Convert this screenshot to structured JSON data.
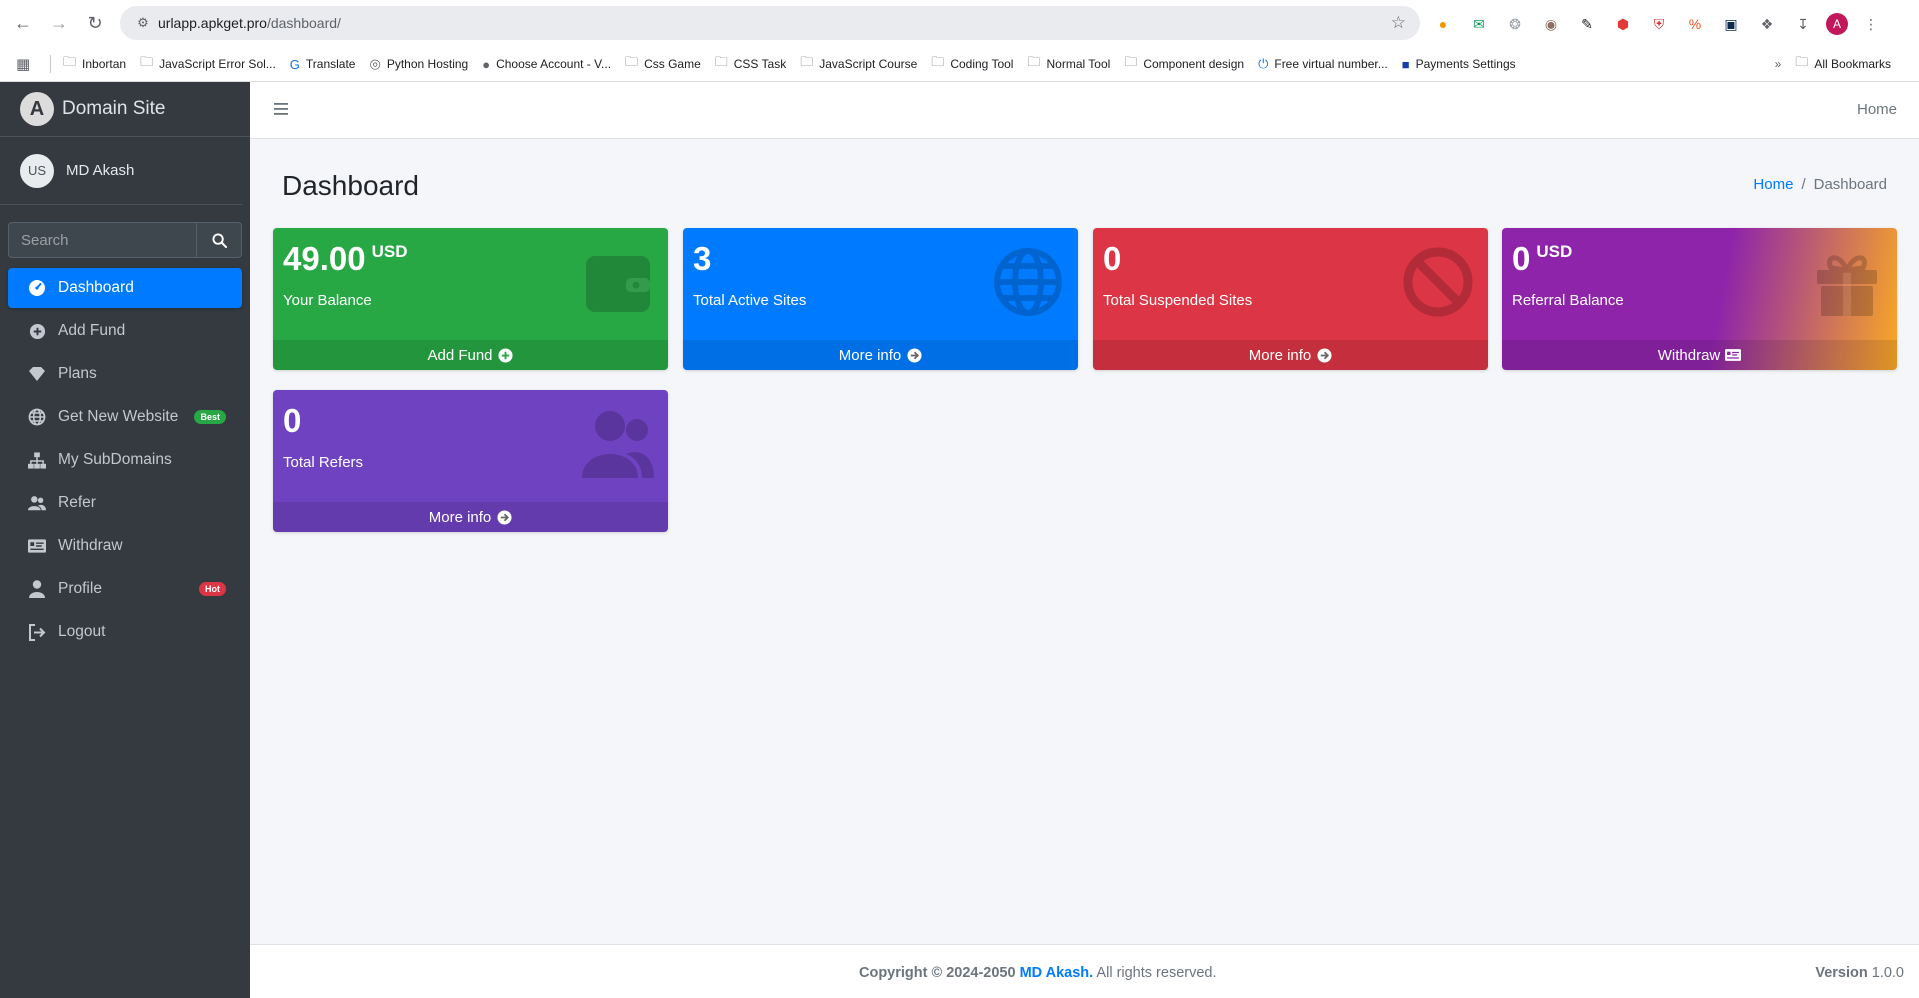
{
  "browser": {
    "url_host": "urlapp.apkget.pro",
    "url_path": "/dashboard/",
    "profile_initial": "A",
    "bookmarks": [
      {
        "label": "Inbortan",
        "icon": "folder-icon"
      },
      {
        "label": "JavaScript Error Sol...",
        "icon": "folder-icon"
      },
      {
        "label": "Translate",
        "icon": "translate-icon"
      },
      {
        "label": "Python Hosting",
        "icon": "globe-icon"
      },
      {
        "label": "Choose Account - V...",
        "icon": "site-icon"
      },
      {
        "label": "Css Game",
        "icon": "folder-icon"
      },
      {
        "label": "CSS Task",
        "icon": "folder-icon"
      },
      {
        "label": "JavaScript Course",
        "icon": "folder-icon"
      },
      {
        "label": "Coding Tool",
        "icon": "folder-icon"
      },
      {
        "label": "Normal Tool",
        "icon": "folder-icon"
      },
      {
        "label": "Component design",
        "icon": "folder-icon"
      },
      {
        "label": "Free virtual number...",
        "icon": "power-icon"
      },
      {
        "label": "Payments Settings",
        "icon": "square-icon"
      }
    ],
    "all_bookmarks": "All Bookmarks"
  },
  "sidebar": {
    "brand": "Domain Site",
    "brand_logo": "A",
    "user_initials": "US",
    "user_name": "MD Akash",
    "search_placeholder": "Search",
    "items": [
      {
        "label": "Dashboard",
        "icon": "dashboard-icon",
        "active": true
      },
      {
        "label": "Add Fund",
        "icon": "plus-circle-icon"
      },
      {
        "label": "Plans",
        "icon": "gem-icon"
      },
      {
        "label": "Get New Website",
        "icon": "globe-icon",
        "badge": "Best"
      },
      {
        "label": "My SubDomains",
        "icon": "sitemap-icon"
      },
      {
        "label": "Refer",
        "icon": "users-icon"
      },
      {
        "label": "Withdraw",
        "icon": "money-check-icon"
      },
      {
        "label": "Profile",
        "icon": "user-icon",
        "badge": "Hot"
      },
      {
        "label": "Logout",
        "icon": "logout-icon"
      }
    ]
  },
  "topbar": {
    "home": "Home"
  },
  "page": {
    "title": "Dashboard",
    "breadcrumb_home": "Home",
    "breadcrumb_sep": "/",
    "breadcrumb_current": "Dashboard"
  },
  "cards": [
    {
      "value": "49.00",
      "unit": "USD",
      "label": "Your Balance",
      "footer": "Add Fund",
      "color": "#28a745",
      "icon": "wallet-icon",
      "footer_icon": "plus-circle-icon"
    },
    {
      "value": "3",
      "unit": "",
      "label": "Total Active Sites",
      "footer": "More info",
      "color": "#007bff",
      "icon": "globe-icon",
      "footer_icon": "arrow-circle-right-icon"
    },
    {
      "value": "0",
      "unit": "",
      "label": "Total Suspended Sites",
      "footer": "More info",
      "color": "#dc3545",
      "icon": "ban-icon",
      "footer_icon": "arrow-circle-right-icon"
    },
    {
      "value": "0",
      "unit": "USD",
      "label": "Referral Balance",
      "footer": "Withdraw",
      "color": "#8e24aa",
      "icon": "gift-icon",
      "footer_icon": "money-check-icon"
    },
    {
      "value": "0",
      "unit": "",
      "label": "Total Refers",
      "footer": "More info",
      "color": "#6f42c1",
      "icon": "users-icon",
      "footer_icon": "arrow-circle-right-icon"
    }
  ],
  "footer": {
    "copyright": "Copyright © 2024-2050",
    "author": "MD Akash.",
    "rights": "All rights reserved.",
    "version_label": "Version",
    "version": "1.0.0"
  }
}
